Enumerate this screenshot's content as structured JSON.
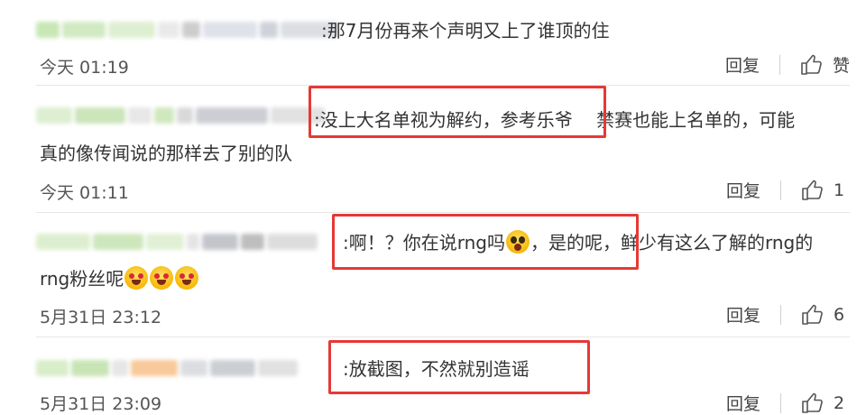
{
  "comments": [
    {
      "text": ":那7月份再来个声明又上了谁顶的住",
      "time": "今天 01:19",
      "reply_label": "回复",
      "like_label": "赞"
    },
    {
      "text_highlight": ":没上大名单视为解约，参考乐爷",
      "text_rest": " 禁赛也能上名单的，可能",
      "text_line2": "真的像传闻说的那样去了别的队",
      "time": "今天 01:11",
      "reply_label": "回复",
      "like_count": "1"
    },
    {
      "text_highlight_a": ":啊！？你在说rng吗",
      "text_highlight_b": "，是的呢，",
      "text_rest": "鲜少有这么了解的rng的",
      "text_line2": "rng粉丝呢",
      "time": "5月31日 23:12",
      "reply_label": "回复",
      "like_count": "6"
    },
    {
      "text_highlight": ":放截图，不然就别造谣",
      "time": "5月31日 23:09",
      "reply_label": "回复",
      "like_count": "2"
    }
  ],
  "colors": {
    "highlight_box": "#e53935",
    "divider": "#e6e6e6"
  },
  "icons": {
    "like": "thumbs-up-icon",
    "emoji_shocked": "shocked-face-emoji",
    "emoji_heart_eyes": "heart-eyes-emoji"
  }
}
